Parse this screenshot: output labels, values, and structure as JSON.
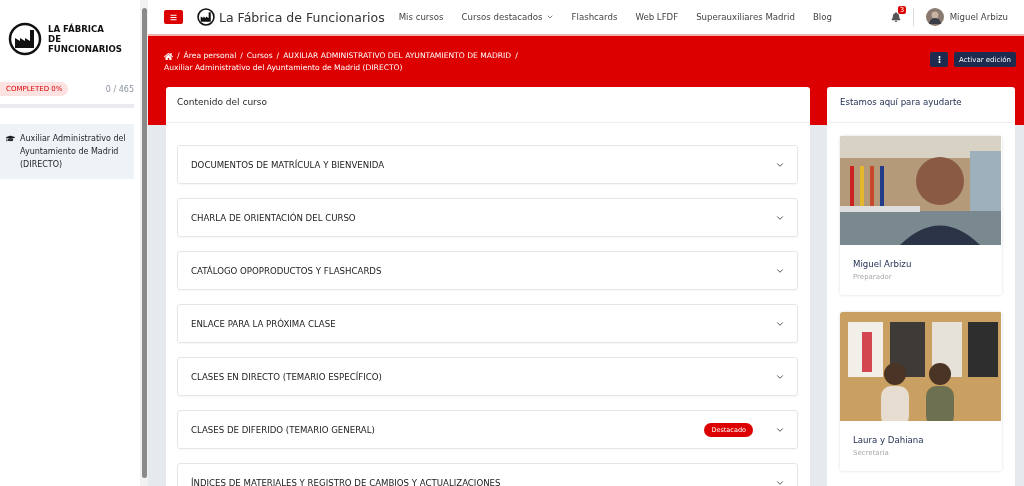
{
  "sidebar": {
    "logo_text": "LA FÁBRICA DE FUNCIONARIOS",
    "progress": {
      "badge": "COMPLETED 0%",
      "count": "0 / 465",
      "level": 0
    },
    "items": [
      {
        "label": "Auxiliar Administrativo del Ayuntamiento de Madrid (DIRECTO)",
        "selected": true
      }
    ]
  },
  "topbar": {
    "brand": "La Fábrica de Funcionarios",
    "nav": [
      {
        "label": "Mis cursos",
        "dropdown": false
      },
      {
        "label": "Cursos destacados",
        "dropdown": true
      },
      {
        "label": "Flashcards",
        "dropdown": false
      },
      {
        "label": "Web LFDF",
        "dropdown": false
      },
      {
        "label": "Superauxiliares Madrid",
        "dropdown": false
      },
      {
        "label": "Blog",
        "dropdown": false
      }
    ],
    "notifications": "3",
    "user": "Miguel Arbizu"
  },
  "breadcrumb": [
    {
      "separator": "/",
      "label": "Área personal"
    },
    {
      "separator": "/",
      "label": "Cursos"
    },
    {
      "separator": "/",
      "label": "AUXILIAR ADMINISTRATIVO DEL AYUNTAMIENTO DE MADRID"
    },
    {
      "separator": "/",
      "label": "Auxiliar Administrativo del Ayuntamiento de Madrid (DIRECTO)"
    }
  ],
  "header_actions": {
    "edit_button": "Activar edición"
  },
  "course": {
    "title": "Contenido del curso",
    "sections": [
      {
        "title": "DOCUMENTOS DE MATRÍCULA Y BIENVENIDA"
      },
      {
        "title": "CHARLA DE ORIENTACIÓN DEL CURSO"
      },
      {
        "title": "CATÁLOGO OPOPRODUCTOS Y FLASHCARDS"
      },
      {
        "title": "ENLACE PARA LA PRÓXIMA CLASE"
      },
      {
        "title": "CLASES EN DIRECTO (TEMARIO ESPECÍFICO)"
      },
      {
        "title": "CLASES DE DIFERIDO (TEMARIO GENERAL)",
        "badge": "Destacado"
      },
      {
        "title": "ÍNDICES DE MATERIALES Y REGISTRO DE CAMBIOS Y ACTUALIZACIONES"
      }
    ]
  },
  "help": {
    "title": "Estamos aquí para ayudarte",
    "people": [
      {
        "kind": "picture",
        "name": "Miguel Arbizu",
        "role": "Preparador"
      },
      {
        "kind": "picture",
        "name": "Laura y Dahiana",
        "role": "Secretaria"
      }
    ]
  }
}
